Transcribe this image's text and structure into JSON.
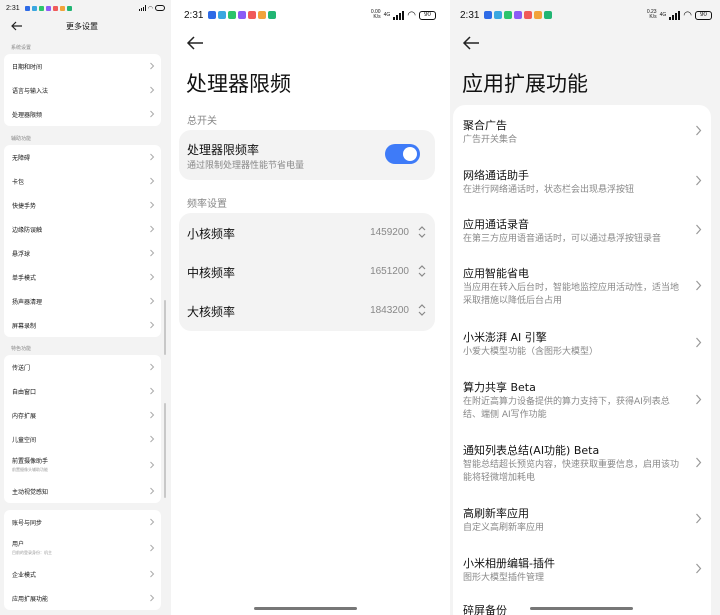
{
  "panel1": {
    "status_time": "2:31",
    "title": "更多设置",
    "sections": [
      {
        "header": "系统设置",
        "items": [
          {
            "label": "日期和时间"
          },
          {
            "label": "语言与输入法"
          },
          {
            "label": "处理器限频"
          }
        ]
      },
      {
        "header": "辅助功能",
        "items": [
          {
            "label": "无障碍"
          },
          {
            "label": "卡包"
          },
          {
            "label": "快捷手势"
          },
          {
            "label": "边缘防误触"
          },
          {
            "label": "悬浮球"
          },
          {
            "label": "单手模式"
          },
          {
            "label": "扬声器清理"
          },
          {
            "label": "屏幕录制"
          }
        ]
      },
      {
        "header": "特色功能",
        "items": [
          {
            "label": "传送门"
          },
          {
            "label": "自由窗口"
          },
          {
            "label": "内存扩展"
          },
          {
            "label": "儿童空间"
          },
          {
            "label": "前置摄像助手",
            "sub": "前置摄像头辅助功能"
          },
          {
            "label": "主动视觉感知"
          }
        ]
      },
      {
        "header": "",
        "items": [
          {
            "label": "账号与同步"
          },
          {
            "label": "用户",
            "sub": "目前的登录身份：机主"
          },
          {
            "label": "企业模式"
          },
          {
            "label": "应用扩展功能"
          }
        ]
      }
    ]
  },
  "panel2": {
    "status_time": "2:31",
    "net_top": "0.00",
    "net_unit": "K/s",
    "net_type": "4G",
    "battery": "90",
    "title": "处理器限频",
    "switch_section": "总开关",
    "switch_label": "处理器限频率",
    "switch_desc": "通过限制处理器性能节省电量",
    "switch_on": true,
    "freq_section": "频率设置",
    "freqs": [
      {
        "label": "小核频率",
        "value": "1459200"
      },
      {
        "label": "中核频率",
        "value": "1651200"
      },
      {
        "label": "大核频率",
        "value": "1843200"
      }
    ]
  },
  "panel3": {
    "status_time": "2:31",
    "net_top": "0.23",
    "net_unit": "K/s",
    "net_type": "4G",
    "battery": "90",
    "title": "应用扩展功能",
    "items": [
      {
        "label": "聚合广告",
        "sub": "广告开关集合"
      },
      {
        "label": "网络通话助手",
        "sub": "在进行网络通话时，状态栏会出现悬浮按钮"
      },
      {
        "label": "应用通话录音",
        "sub": "在第三方应用语音通话时，可以通过悬浮按钮录音"
      },
      {
        "label": "应用智能省电",
        "sub": "当应用在转入后台时，智能地监控应用活动性，适当地采取措施以降低后台占用"
      },
      {
        "label": "小米澎湃 AI 引擎",
        "sub": "小爱大模型功能（含图形大模型）"
      },
      {
        "label": "算力共享 Beta",
        "sub": "在附近高算力设备提供的算力支持下，获得AI列表总结、端侧 AI写作功能"
      },
      {
        "label": "通知列表总结(AI功能) Beta",
        "sub": "智能总结超长预览内容，快速获取重要信息，启用该功能将轻微增加耗电"
      },
      {
        "label": "高刷新率应用",
        "sub": "自定义高刷新率应用"
      },
      {
        "label": "小米相册编辑-插件",
        "sub": "图形大模型插件管理"
      },
      {
        "label": "碎屏备份",
        "sub": ""
      }
    ]
  },
  "colors": {
    "accent": "#3e7bf8",
    "app_icons": [
      "#2e6be6",
      "#3aa7e0",
      "#2cc46b",
      "#8b5cf6",
      "#f05a5a",
      "#f2a33a",
      "#21b573"
    ]
  }
}
